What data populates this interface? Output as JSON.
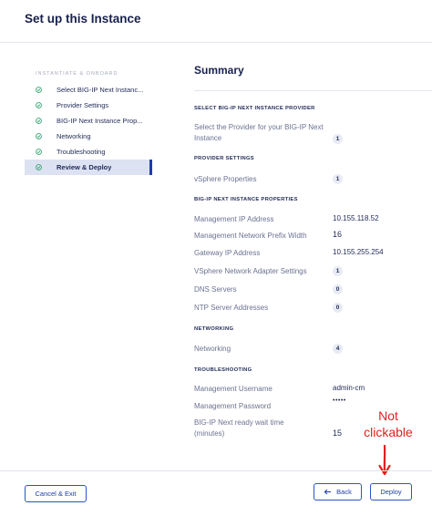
{
  "page": {
    "title": "Set up this Instance"
  },
  "sidebar": {
    "heading": "INSTANTIATE & ONBOARD",
    "items": [
      {
        "label": "Select BIG-IP Next Instanc..."
      },
      {
        "label": "Provider Settings"
      },
      {
        "label": "BIG-IP Next Instance Prop..."
      },
      {
        "label": "Networking"
      },
      {
        "label": "Troubleshooting"
      },
      {
        "label": "Review & Deploy"
      }
    ]
  },
  "summary": {
    "title": "Summary",
    "sections": {
      "provider": {
        "heading": "SELECT BIG-IP NEXT INSTANCE PROVIDER",
        "rows": [
          {
            "label": "Select the Provider for your BIG-IP Next Instance",
            "value": "1"
          }
        ]
      },
      "settings": {
        "heading": "PROVIDER SETTINGS",
        "rows": [
          {
            "label": "vSphere Properties",
            "value": "1"
          }
        ]
      },
      "props": {
        "heading": "BIG-IP NEXT INSTANCE PROPERTIES",
        "rows": [
          {
            "label": "Management IP Address",
            "value": "10.155.118.52"
          },
          {
            "label": "Management Network Prefix Width",
            "value": "16"
          },
          {
            "label": "Gateway IP Address",
            "value": "10.155.255.254"
          },
          {
            "label": "VSphere Network Adapter Settings",
            "value": "1"
          },
          {
            "label": "DNS Servers",
            "value": "0"
          },
          {
            "label": "NTP Server Addresses",
            "value": "0"
          }
        ]
      },
      "networking": {
        "heading": "NETWORKING",
        "rows": [
          {
            "label": "Networking",
            "value": "4"
          }
        ]
      },
      "troubleshooting": {
        "heading": "TROUBLESHOOTING",
        "rows": [
          {
            "label": "Management Username",
            "value": "admin-cm"
          },
          {
            "label": "Management Password",
            "value": "•••••"
          },
          {
            "label": "BIG-IP Next ready wait time (minutes)",
            "value": "15"
          }
        ]
      }
    }
  },
  "footer": {
    "cancel_label": "Cancel & Exit",
    "back_label": "Back",
    "deploy_label": "Deploy"
  },
  "annotation": {
    "line1": "Not",
    "line2": "clickable"
  },
  "colors": {
    "accent": "#2b54c8",
    "check": "#29a36a",
    "annotation": "#e02020"
  }
}
